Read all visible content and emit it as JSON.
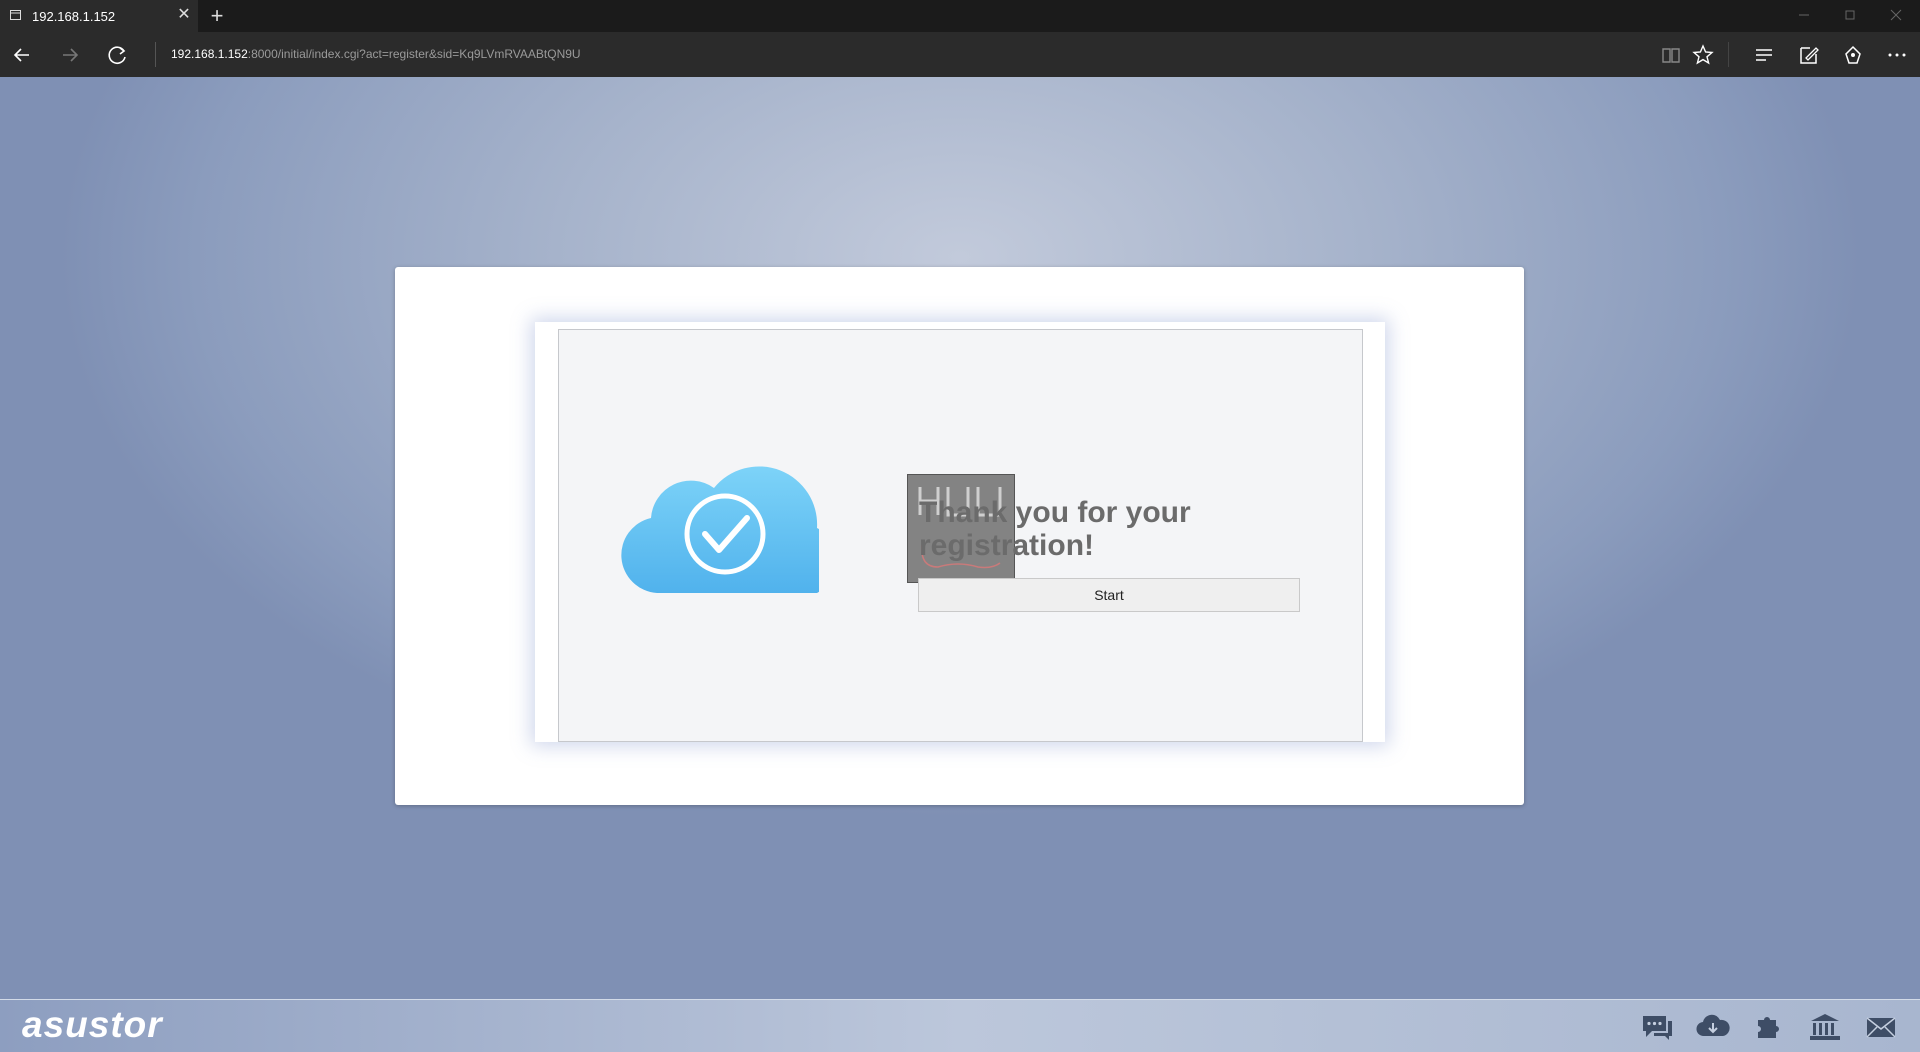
{
  "browser": {
    "tab_title": "192.168.1.152",
    "tab_close": "✕",
    "new_tab": "+",
    "address_host": "192.168.1.152",
    "address_rest": ":8000/initial/index.cgi?act=register&sid=Kq9LVmRVAABtQN9U"
  },
  "main": {
    "thanks_line1": "Thank you for your",
    "thanks_line2": "registration!",
    "start_button": "Start"
  },
  "taskbar": {
    "logo": "asustor",
    "icons": [
      "chat-icon",
      "cloud-download-icon",
      "plugin-icon",
      "bank-icon",
      "mail-icon"
    ]
  },
  "colors": {
    "cloud_top": "#7dd3f8",
    "cloud_bottom": "#4fb1ec",
    "heading": "#6b6b6b"
  }
}
